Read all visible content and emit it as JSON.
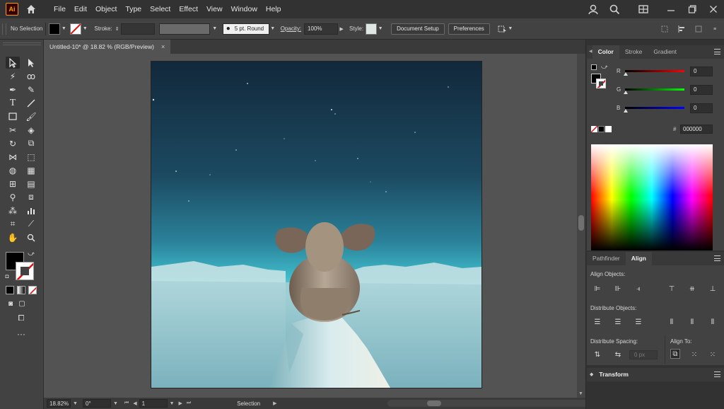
{
  "app": {
    "logo_text": "Ai",
    "menu": [
      "File",
      "Edit",
      "Object",
      "Type",
      "Select",
      "Effect",
      "View",
      "Window",
      "Help"
    ]
  },
  "control_bar": {
    "selection": "No Selection",
    "stroke_label": "Stroke:",
    "brush": "5 pt. Round",
    "opacity_label": "Opacity:",
    "opacity_value": "100%",
    "style_label": "Style:",
    "document_setup": "Document Setup",
    "preferences": "Preferences"
  },
  "document": {
    "tab_title": "Untitled-10* @ 18.82 % (RGB/Preview)",
    "close_glyph": "×"
  },
  "status": {
    "zoom": "18.82%",
    "rotation": "0°",
    "artboard": "1",
    "mode": "Selection"
  },
  "color_panel": {
    "tabs": [
      "Color",
      "Stroke",
      "Gradient"
    ],
    "channels": [
      {
        "label": "R",
        "value": "0",
        "gradient": "linear-gradient(to right,#000,#ff0000)"
      },
      {
        "label": "G",
        "value": "0",
        "gradient": "linear-gradient(to right,#000,#00ff00)"
      },
      {
        "label": "B",
        "value": "0",
        "gradient": "linear-gradient(to right,#000,#0000ff)"
      }
    ],
    "hex_symbol": "#",
    "hex": "000000"
  },
  "align_panel": {
    "tabs": [
      "Pathfinder",
      "Align"
    ],
    "align_objects": "Align Objects:",
    "distribute_objects": "Distribute Objects:",
    "distribute_spacing": "Distribute Spacing:",
    "align_to": "Align To:",
    "spacing_value": "0 px"
  },
  "transform_panel": {
    "title": "Transform"
  },
  "colors": {
    "accent_orange": "#ff9a00",
    "sky_top": "#13293d",
    "sky_bottom": "#36b6c7",
    "fill": "#000000",
    "none_slash": "#e01010"
  }
}
